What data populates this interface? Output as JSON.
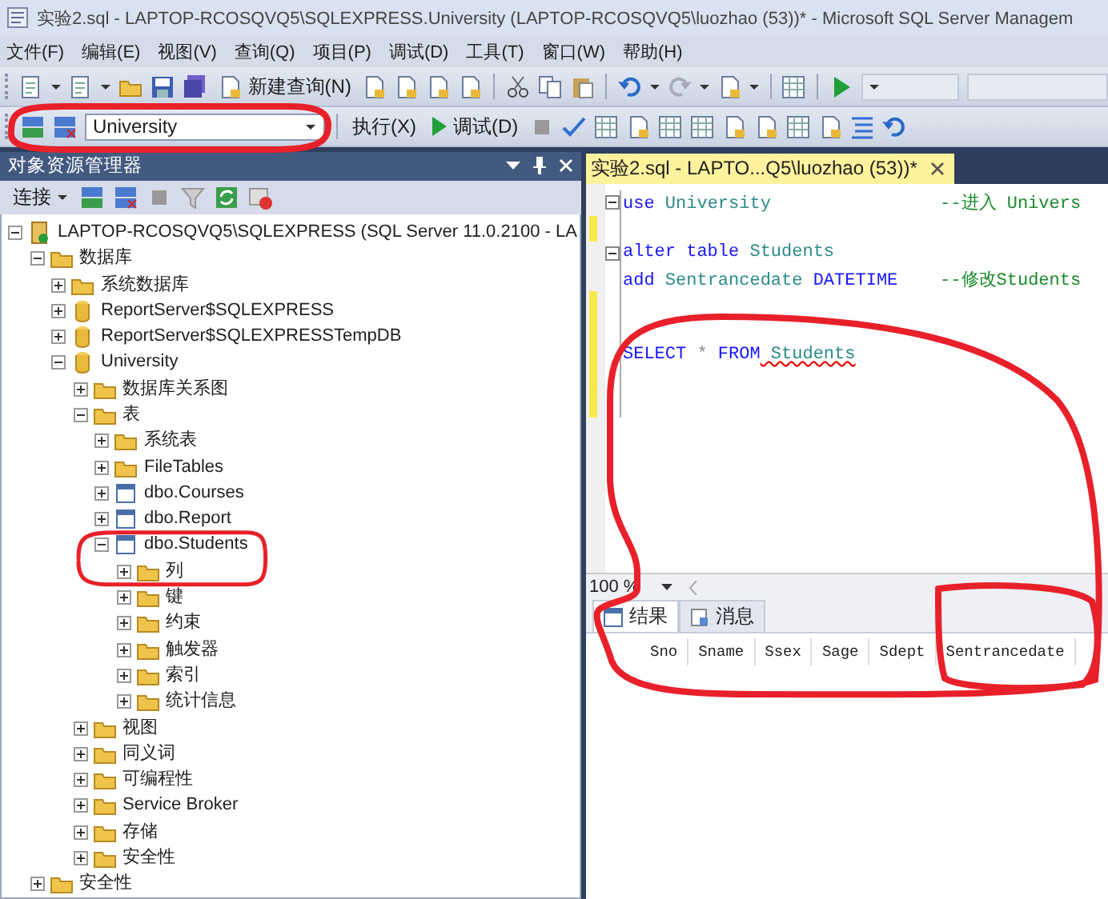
{
  "window": {
    "title": "实验2.sql - LAPTOP-RCOSQVQ5\\SQLEXPRESS.University (LAPTOP-RCOSQVQ5\\luozhao (53))* - Microsoft SQL Server Managem"
  },
  "menu": [
    "文件(F)",
    "编辑(E)",
    "视图(V)",
    "查询(Q)",
    "项目(P)",
    "调试(D)",
    "工具(T)",
    "窗口(W)",
    "帮助(H)"
  ],
  "toolbar": {
    "new_query": "新建查询(N)",
    "database": "University",
    "execute": "执行(X)",
    "debug": "调试(D)"
  },
  "object_explorer": {
    "title": "对象资源管理器",
    "connect": "连接",
    "tree": [
      {
        "label": "LAPTOP-RCOSQVQ5\\SQLEXPRESS (SQL Server 11.0.2100 - LA",
        "kind": "server",
        "expanded": true,
        "children": [
          {
            "label": "数据库",
            "kind": "folder",
            "expanded": true,
            "children": [
              {
                "label": "系统数据库",
                "kind": "folder",
                "expanded": false
              },
              {
                "label": "ReportServer$SQLEXPRESS",
                "kind": "database",
                "expanded": false
              },
              {
                "label": "ReportServer$SQLEXPRESSTempDB",
                "kind": "database",
                "expanded": false
              },
              {
                "label": "University",
                "kind": "database",
                "expanded": true,
                "children": [
                  {
                    "label": "数据库关系图",
                    "kind": "folder",
                    "expanded": false
                  },
                  {
                    "label": "表",
                    "kind": "folder",
                    "expanded": true,
                    "children": [
                      {
                        "label": "系统表",
                        "kind": "folder",
                        "expanded": false
                      },
                      {
                        "label": "FileTables",
                        "kind": "folder",
                        "expanded": false
                      },
                      {
                        "label": "dbo.Courses",
                        "kind": "table",
                        "expanded": false
                      },
                      {
                        "label": "dbo.Report",
                        "kind": "table",
                        "expanded": false
                      },
                      {
                        "label": "dbo.Students",
                        "kind": "table",
                        "expanded": true,
                        "children": [
                          {
                            "label": "列",
                            "kind": "folder",
                            "expanded": false
                          },
                          {
                            "label": "键",
                            "kind": "folder",
                            "expanded": false
                          },
                          {
                            "label": "约束",
                            "kind": "folder",
                            "expanded": false
                          },
                          {
                            "label": "触发器",
                            "kind": "folder",
                            "expanded": false
                          },
                          {
                            "label": "索引",
                            "kind": "folder",
                            "expanded": false
                          },
                          {
                            "label": "统计信息",
                            "kind": "folder",
                            "expanded": false
                          }
                        ]
                      }
                    ]
                  },
                  {
                    "label": "视图",
                    "kind": "folder",
                    "expanded": false
                  },
                  {
                    "label": "同义词",
                    "kind": "folder",
                    "expanded": false
                  },
                  {
                    "label": "可编程性",
                    "kind": "folder",
                    "expanded": false
                  },
                  {
                    "label": "Service Broker",
                    "kind": "folder",
                    "expanded": false
                  },
                  {
                    "label": "存储",
                    "kind": "folder",
                    "expanded": false
                  },
                  {
                    "label": "安全性",
                    "kind": "folder",
                    "expanded": false
                  }
                ]
              }
            ]
          },
          {
            "label": "安全性",
            "kind": "folder",
            "expanded": false
          }
        ]
      }
    ]
  },
  "editor": {
    "tab": "实验2.sql - LAPTO...Q5\\luozhao (53))*",
    "lines": [
      {
        "fold": true,
        "changed": false,
        "tokens": [
          {
            "kind": "keyword",
            "text": "use"
          },
          {
            "kind": "identifier",
            "text": " University"
          },
          {
            "kind": "comment",
            "text": "                --进入 Univers"
          }
        ]
      },
      {
        "fold": false,
        "changed": true
      },
      {
        "fold": true,
        "changed": false,
        "tokens": [
          {
            "kind": "keyword",
            "text": "alter table"
          },
          {
            "kind": "identifier",
            "text": " Students"
          }
        ]
      },
      {
        "fold": false,
        "changed": false,
        "tokens": [
          {
            "kind": "keyword",
            "text": "add"
          },
          {
            "kind": "identifier",
            "text": " Sentrancedate"
          },
          {
            "kind": "keyword",
            "text": " DATETIME"
          },
          {
            "kind": "comment",
            "text": "    --修改Students"
          }
        ]
      },
      {
        "fold": false,
        "changed": true
      },
      {
        "fold": false,
        "changed": true
      },
      {
        "fold": false,
        "changed": true,
        "tokens": [
          {
            "kind": "keyword",
            "text": "SELECT"
          },
          {
            "kind": "operator",
            "text": " *"
          },
          {
            "kind": "keyword",
            "text": " FROM"
          },
          {
            "kind": "error",
            "text": " Students"
          }
        ]
      },
      {
        "fold": false,
        "changed": true
      },
      {
        "fold": false,
        "changed": true
      }
    ],
    "zoom": "100 %"
  },
  "results": {
    "tabs": [
      {
        "label": "结果",
        "selected": true
      },
      {
        "label": "消息",
        "selected": false
      }
    ],
    "columns": [
      "Sno",
      "Sname",
      "Ssex",
      "Sage",
      "Sdept",
      "Sentrancedate"
    ]
  }
}
